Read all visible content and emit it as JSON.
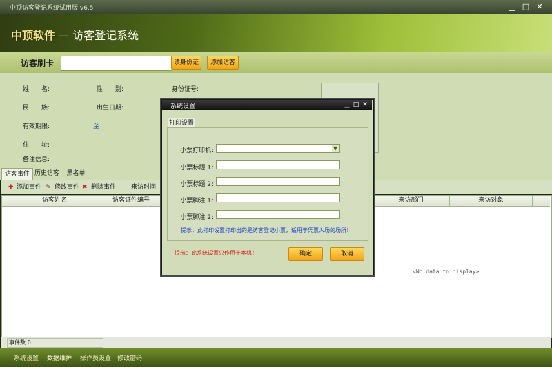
{
  "window": {
    "title": "中顶访客登记系统试用版 v6.5",
    "minimize_glyph": "▁",
    "maximize_glyph": "□",
    "close_glyph": "✕"
  },
  "header": {
    "brand": "中顶软件",
    "system_title": "— 访客登记系统"
  },
  "cardbar": {
    "label": "访客刷卡",
    "card_value": "",
    "read_id_button": "读身份证",
    "add_visitor_button": "添加访客"
  },
  "info": {
    "name_label": "姓　　名:",
    "gender_label": "性　　别:",
    "id_label": "身份证号:",
    "ethnicity_label": "民　　族:",
    "birth_label": "出生日期:",
    "validity_label": "有效期限:",
    "validity_to": "至",
    "address_label": "住　　址:",
    "remarks_label": "备注信息:"
  },
  "tabs": [
    "访客事件",
    "历史访客",
    "黑名单"
  ],
  "toolbar": {
    "add": "添加事件",
    "edit": "修改事件",
    "delete": "删除事件",
    "visit_time_label": "来访时间:"
  },
  "grid": {
    "columns": [
      "访客姓名",
      "访客证件编号",
      "来访部门",
      "来访对象"
    ],
    "empty_text": "<No data to display>"
  },
  "status": {
    "event_count": "事件数:0"
  },
  "footer": {
    "links": [
      "系统设置",
      "数据维护",
      "操作员设置",
      "修改密码"
    ]
  },
  "dialog": {
    "title": "系统设置",
    "tab": "打印设置",
    "fields": [
      {
        "label": "小票打印机:",
        "value": ""
      },
      {
        "label": "小票标题 1:",
        "value": ""
      },
      {
        "label": "小票标题 2:",
        "value": ""
      },
      {
        "label": "小票脚注 1:",
        "value": ""
      },
      {
        "label": "小票脚注 2:",
        "value": ""
      }
    ],
    "hint": "提示：此打印设置打印出的是访客登记小票，适用于凭票入场的场所！",
    "note": "提示：此系统设置只作用于本机！",
    "ok": "确定",
    "cancel": "取消"
  },
  "colors": {
    "accent": "#f3a418",
    "hint_blue": "#1a3fbf",
    "note_red": "#d21a1a",
    "panel_green": "#cfdcb4"
  }
}
